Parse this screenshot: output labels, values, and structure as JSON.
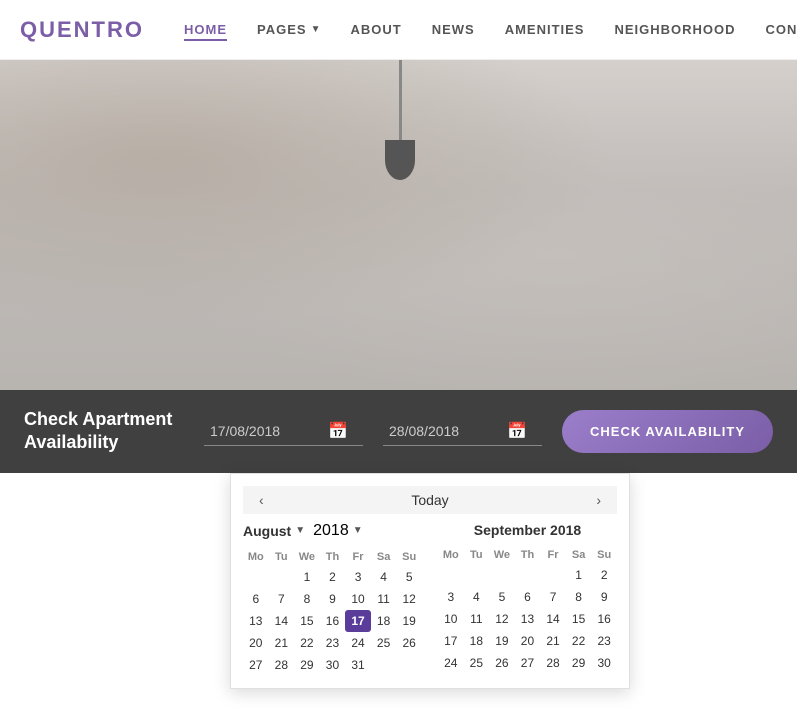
{
  "brand": {
    "name_before": "QU",
    "name_accent": "E",
    "name_after": "NTRO"
  },
  "nav": {
    "items": [
      {
        "label": "HOME",
        "active": true
      },
      {
        "label": "PAGES",
        "has_dropdown": true
      },
      {
        "label": "ABOUT",
        "active": false
      },
      {
        "label": "NEWS",
        "active": false
      },
      {
        "label": "AMENITIES",
        "active": false
      },
      {
        "label": "NEIGHBORHOOD",
        "active": false
      },
      {
        "label": "CONTACT",
        "active": false
      }
    ]
  },
  "availability": {
    "title": "Check Apartment\nAvailability",
    "start_date": "17/08/2018",
    "end_date": "28/08/2018",
    "button_label": "CHECK AVAILABILITY",
    "today_label": "Today"
  },
  "calendar": {
    "left": {
      "month_label": "August",
      "year_label": "2018",
      "days_header": [
        "Mo",
        "Tu",
        "We",
        "Th",
        "Fr",
        "Sa",
        "Su"
      ],
      "weeks": [
        [
          "",
          "",
          "1",
          "2",
          "3",
          "4",
          "5"
        ],
        [
          "6",
          "7",
          "8",
          "9",
          "10",
          "11",
          "12"
        ],
        [
          "13",
          "14",
          "15",
          "16",
          "17",
          "18",
          "19"
        ],
        [
          "20",
          "21",
          "22",
          "23",
          "24",
          "25",
          "26"
        ],
        [
          "27",
          "28",
          "29",
          "30",
          "31",
          "",
          ""
        ]
      ],
      "today_date": "17"
    },
    "right": {
      "month_label": "September 2018",
      "days_header": [
        "Mo",
        "Tu",
        "We",
        "Th",
        "Fr",
        "Sa",
        "Su"
      ],
      "weeks": [
        [
          "",
          "",
          "",
          "",
          "",
          "1",
          "2"
        ],
        [
          "3",
          "4",
          "5",
          "6",
          "7",
          "8",
          "9"
        ],
        [
          "10",
          "11",
          "12",
          "13",
          "14",
          "15",
          "16"
        ],
        [
          "17",
          "18",
          "19",
          "20",
          "21",
          "22",
          "23"
        ],
        [
          "24",
          "25",
          "26",
          "27",
          "28",
          "29",
          "30"
        ]
      ]
    }
  }
}
